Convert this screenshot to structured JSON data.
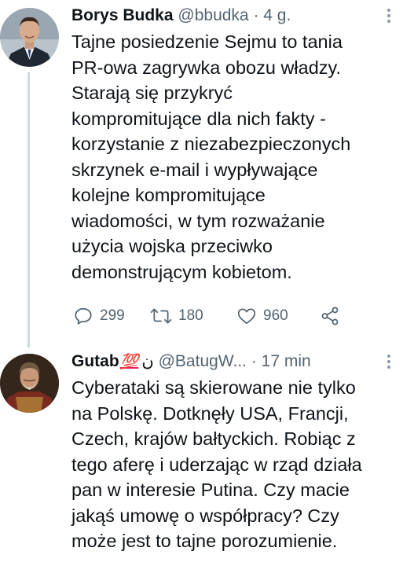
{
  "tweets": [
    {
      "name": "Borys Budka",
      "handle": "@bbudka",
      "separator": "·",
      "time": "4 g.",
      "lines": [
        "Tajne posiedzenie Sejmu to tania",
        "PR-owa zagrywka obozu władzy.",
        "Starają się przykryć",
        "kompromitujące dla nich fakty -",
        "korzystanie z niezabezpieczonych",
        "skrzynek e-mail i wypływające",
        "kolejne kompromitujące",
        "wiadomości, w tym rozważanie",
        "użycia wojska przeciwko",
        "demonstrującym kobietom."
      ],
      "replies": "299",
      "retweets": "180",
      "likes": "960",
      "icons": [
        "reply-icon",
        "retweet-icon",
        "like-icon",
        "share-icon",
        "more-icon"
      ]
    },
    {
      "name": "Gutab",
      "name_emoji": "💯",
      "name_glyph": "ن",
      "handle": "@BatugW...",
      "separator": "·",
      "time": "17 min",
      "lines": [
        "Cyberataki są skierowane nie tylko",
        "na Polskę. Dotknęły USA, Francji,",
        "Czech, krajów bałtyckich. Robiąc z",
        "tego aferę i uderzając w rząd działa",
        "pan w interesie Putina. Czy macie",
        "jakąś umowę o współpracy? Czy",
        "może jest to tajne porozumienie."
      ]
    }
  ],
  "colors": {
    "text": "#0f1419",
    "secondary": "#536471",
    "thread_line": "#cfd9de",
    "accent_100": "#e0245e"
  }
}
